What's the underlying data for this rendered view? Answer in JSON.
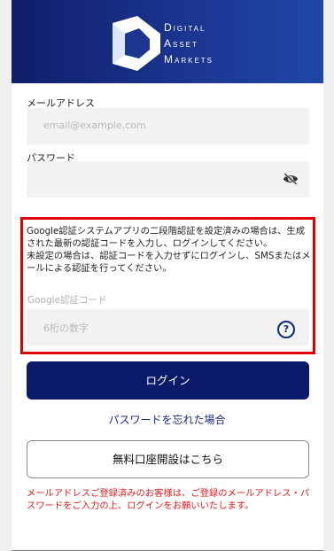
{
  "header": {
    "brand_line1": "Digital",
    "brand_line2": "Asset",
    "brand_line3": "Markets"
  },
  "form": {
    "email_label": "メールアドレス",
    "email_placeholder": "email@example.com",
    "password_label": "パスワード",
    "password_placeholder": "",
    "password_toggle_icon": "eye-off-icon"
  },
  "google_auth": {
    "info_text": "Google認証システムアプリの二段階認証を設定済みの場合は、生成された最新の認証コードを入力し、ログインしてください。\n未設定の場合は、認証コードを入力せずにログインし、SMSまたはメールによる認証を行ってください。",
    "label": "Google認証コード",
    "placeholder": "6桁の数字",
    "help_icon": "question-icon",
    "help_icon_text": "?"
  },
  "actions": {
    "login_label": "ログイン",
    "forgot_password_label": "パスワードを忘れた場合",
    "open_account_label": "無料口座開設はこちら"
  },
  "notice": {
    "text": "メールアドレスご登録済みのお客様は、ご登録のメールアドレス・パスワードをご入力の上、ログインをお願いいたします。"
  },
  "colors": {
    "header_start": "#101e6a",
    "header_end": "#1f47a8",
    "primary_button": "#0b1a6b",
    "highlight_border": "#e10000",
    "notice_text": "#e41a1a"
  }
}
